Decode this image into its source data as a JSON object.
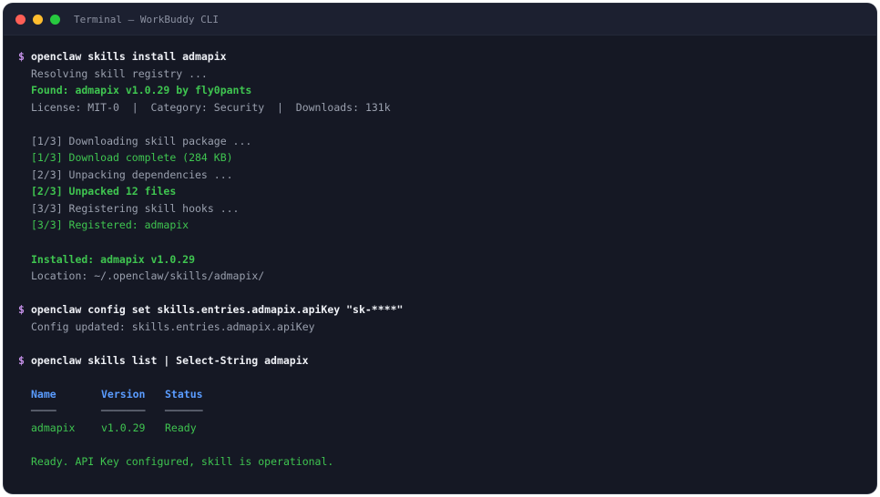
{
  "window": {
    "title": "Terminal — WorkBuddy CLI",
    "dot_colors": [
      "#ff5f56",
      "#ffbd2e",
      "#27c93f"
    ]
  },
  "prompt_symbol": "$",
  "lines": {
    "cmd1": "openclaw skills install admapix",
    "resolving": "Resolving skill registry ...",
    "found": "Found: admapix v1.0.29 by fly0pants",
    "license": "License: MIT-0  |  Category: Security  |  Downloads: 131k",
    "dl": "[1/3] Downloading skill package ...",
    "dl_done": "[1/3] Download complete (284 KB)",
    "unpack": "[2/3] Unpacking dependencies ...",
    "unpack_done": "[2/3] Unpacked 12 files",
    "hooks": "[3/3] Registering skill hooks ...",
    "registered": "[3/3] Registered: admapix",
    "installed": "Installed: admapix v1.0.29",
    "location": "Location: ~/.openclaw/skills/admapix/",
    "cmd2": "openclaw config set skills.entries.admapix.apiKey \"sk-****\"",
    "config_updated": "Config updated: skills.entries.admapix.apiKey",
    "cmd3": "openclaw skills list | Select-String admapix",
    "ready_msg": "Ready. API Key configured, skill is operational."
  },
  "table": {
    "headers": [
      "Name",
      "Version",
      "Status"
    ],
    "separators": [
      "────",
      "───────",
      "──────"
    ],
    "rows": [
      [
        "admapix",
        "v1.0.29",
        "Ready"
      ]
    ]
  }
}
